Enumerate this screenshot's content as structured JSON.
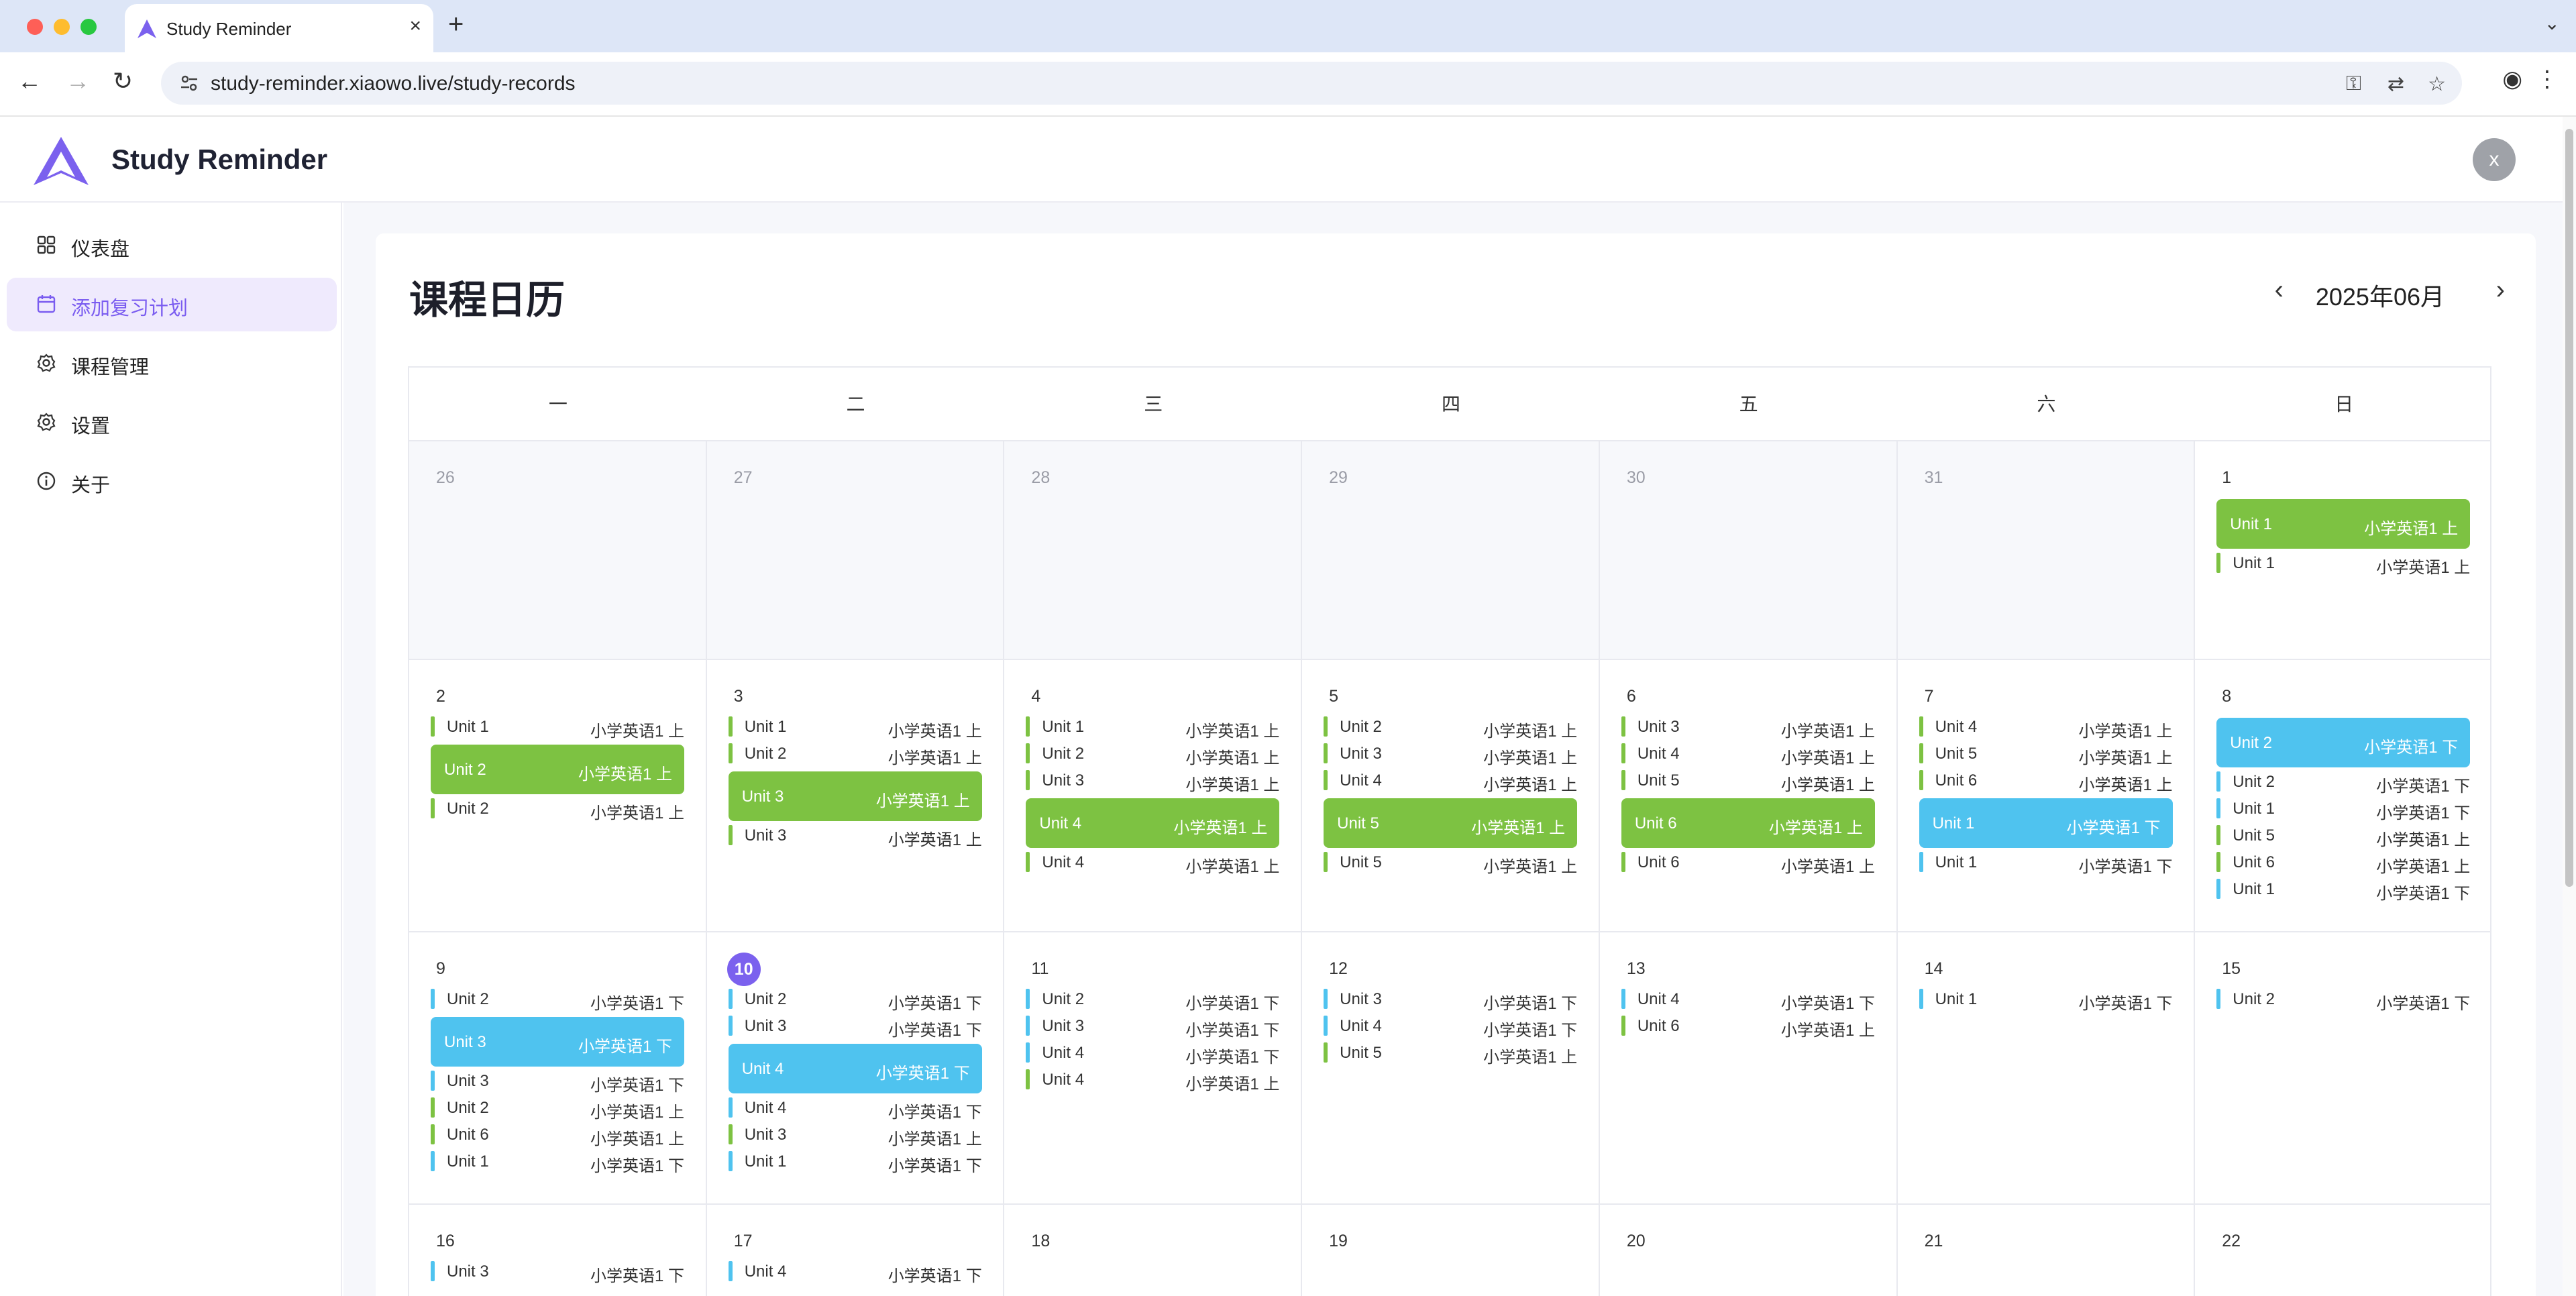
{
  "browser": {
    "tab_title": "Study Reminder",
    "url": "study-reminder.xiaowo.live/study-records"
  },
  "app": {
    "brand": "Study Reminder",
    "avatar_letter": "x"
  },
  "sidebar": {
    "items": [
      {
        "label": "仪表盘",
        "icon": "dashboard-icon"
      },
      {
        "label": "添加复习计划",
        "icon": "calendar-icon",
        "active": true
      },
      {
        "label": "课程管理",
        "icon": "gear-icon"
      },
      {
        "label": "设置",
        "icon": "gear-icon"
      },
      {
        "label": "关于",
        "icon": "info-icon"
      }
    ]
  },
  "main": {
    "title": "课程日历",
    "month": "2025年06月",
    "weekdays": [
      "一",
      "二",
      "三",
      "四",
      "五",
      "六",
      "日"
    ]
  },
  "colors": {
    "accent": "#7b61ee",
    "green": "#7dc242",
    "blue": "#4fc3ef"
  },
  "calendar": {
    "weeks": [
      [
        {
          "day": "26",
          "other": true,
          "events": []
        },
        {
          "day": "27",
          "other": true,
          "events": []
        },
        {
          "day": "28",
          "other": true,
          "events": []
        },
        {
          "day": "29",
          "other": true,
          "events": []
        },
        {
          "day": "30",
          "other": true,
          "events": []
        },
        {
          "day": "31",
          "other": true,
          "events": []
        },
        {
          "day": "1",
          "events": [
            {
              "unit": "Unit 1",
              "course": "小学英语1 上",
              "color": "green",
              "hl": true
            },
            {
              "unit": "Unit 1",
              "course": "小学英语1 上",
              "color": "green"
            }
          ]
        }
      ],
      [
        {
          "day": "2",
          "events": [
            {
              "unit": "Unit 1",
              "course": "小学英语1 上",
              "color": "green"
            },
            {
              "unit": "Unit 2",
              "course": "小学英语1 上",
              "color": "green",
              "hl": true
            },
            {
              "unit": "Unit 2",
              "course": "小学英语1 上",
              "color": "green"
            }
          ]
        },
        {
          "day": "3",
          "events": [
            {
              "unit": "Unit 1",
              "course": "小学英语1 上",
              "color": "green"
            },
            {
              "unit": "Unit 2",
              "course": "小学英语1 上",
              "color": "green"
            },
            {
              "unit": "Unit 3",
              "course": "小学英语1 上",
              "color": "green",
              "hl": true
            },
            {
              "unit": "Unit 3",
              "course": "小学英语1 上",
              "color": "green"
            }
          ]
        },
        {
          "day": "4",
          "events": [
            {
              "unit": "Unit 1",
              "course": "小学英语1 上",
              "color": "green"
            },
            {
              "unit": "Unit 2",
              "course": "小学英语1 上",
              "color": "green"
            },
            {
              "unit": "Unit 3",
              "course": "小学英语1 上",
              "color": "green"
            },
            {
              "unit": "Unit 4",
              "course": "小学英语1 上",
              "color": "green",
              "hl": true
            },
            {
              "unit": "Unit 4",
              "course": "小学英语1 上",
              "color": "green"
            }
          ]
        },
        {
          "day": "5",
          "events": [
            {
              "unit": "Unit 2",
              "course": "小学英语1 上",
              "color": "green"
            },
            {
              "unit": "Unit 3",
              "course": "小学英语1 上",
              "color": "green"
            },
            {
              "unit": "Unit 4",
              "course": "小学英语1 上",
              "color": "green"
            },
            {
              "unit": "Unit 5",
              "course": "小学英语1 上",
              "color": "green",
              "hl": true
            },
            {
              "unit": "Unit 5",
              "course": "小学英语1 上",
              "color": "green"
            }
          ]
        },
        {
          "day": "6",
          "events": [
            {
              "unit": "Unit 3",
              "course": "小学英语1 上",
              "color": "green"
            },
            {
              "unit": "Unit 4",
              "course": "小学英语1 上",
              "color": "green"
            },
            {
              "unit": "Unit 5",
              "course": "小学英语1 上",
              "color": "green"
            },
            {
              "unit": "Unit 6",
              "course": "小学英语1 上",
              "color": "green",
              "hl": true
            },
            {
              "unit": "Unit 6",
              "course": "小学英语1 上",
              "color": "green"
            }
          ]
        },
        {
          "day": "7",
          "events": [
            {
              "unit": "Unit 4",
              "course": "小学英语1 上",
              "color": "green"
            },
            {
              "unit": "Unit 5",
              "course": "小学英语1 上",
              "color": "green"
            },
            {
              "unit": "Unit 6",
              "course": "小学英语1 上",
              "color": "green"
            },
            {
              "unit": "Unit 1",
              "course": "小学英语1 下",
              "color": "blue",
              "hl": true
            },
            {
              "unit": "Unit 1",
              "course": "小学英语1 下",
              "color": "blue"
            }
          ]
        },
        {
          "day": "8",
          "events": [
            {
              "unit": "Unit 2",
              "course": "小学英语1 下",
              "color": "blue",
              "hl": true
            },
            {
              "unit": "Unit 2",
              "course": "小学英语1 下",
              "color": "blue"
            },
            {
              "unit": "Unit 1",
              "course": "小学英语1 下",
              "color": "blue"
            },
            {
              "unit": "Unit 5",
              "course": "小学英语1 上",
              "color": "green"
            },
            {
              "unit": "Unit 6",
              "course": "小学英语1 上",
              "color": "green"
            },
            {
              "unit": "Unit 1",
              "course": "小学英语1 下",
              "color": "blue"
            }
          ]
        }
      ],
      [
        {
          "day": "9",
          "events": [
            {
              "unit": "Unit 2",
              "course": "小学英语1 下",
              "color": "blue"
            },
            {
              "unit": "Unit 3",
              "course": "小学英语1 下",
              "color": "blue",
              "hl": true
            },
            {
              "unit": "Unit 3",
              "course": "小学英语1 下",
              "color": "blue"
            },
            {
              "unit": "Unit 2",
              "course": "小学英语1 上",
              "color": "green"
            },
            {
              "unit": "Unit 6",
              "course": "小学英语1 上",
              "color": "green"
            },
            {
              "unit": "Unit 1",
              "course": "小学英语1 下",
              "color": "blue"
            }
          ]
        },
        {
          "day": "10",
          "today": true,
          "events": [
            {
              "unit": "Unit 2",
              "course": "小学英语1 下",
              "color": "blue"
            },
            {
              "unit": "Unit 3",
              "course": "小学英语1 下",
              "color": "blue"
            },
            {
              "unit": "Unit 4",
              "course": "小学英语1 下",
              "color": "blue",
              "hl": true
            },
            {
              "unit": "Unit 4",
              "course": "小学英语1 下",
              "color": "blue"
            },
            {
              "unit": "Unit 3",
              "course": "小学英语1 上",
              "color": "green"
            },
            {
              "unit": "Unit 1",
              "course": "小学英语1 下",
              "color": "blue"
            }
          ]
        },
        {
          "day": "11",
          "events": [
            {
              "unit": "Unit 2",
              "course": "小学英语1 下",
              "color": "blue"
            },
            {
              "unit": "Unit 3",
              "course": "小学英语1 下",
              "color": "blue"
            },
            {
              "unit": "Unit 4",
              "course": "小学英语1 下",
              "color": "blue"
            },
            {
              "unit": "Unit 4",
              "course": "小学英语1 上",
              "color": "green"
            }
          ]
        },
        {
          "day": "12",
          "events": [
            {
              "unit": "Unit 3",
              "course": "小学英语1 下",
              "color": "blue"
            },
            {
              "unit": "Unit 4",
              "course": "小学英语1 下",
              "color": "blue"
            },
            {
              "unit": "Unit 5",
              "course": "小学英语1 上",
              "color": "green"
            }
          ]
        },
        {
          "day": "13",
          "events": [
            {
              "unit": "Unit 4",
              "course": "小学英语1 下",
              "color": "blue"
            },
            {
              "unit": "Unit 6",
              "course": "小学英语1 上",
              "color": "green"
            }
          ]
        },
        {
          "day": "14",
          "events": [
            {
              "unit": "Unit 1",
              "course": "小学英语1 下",
              "color": "blue"
            }
          ]
        },
        {
          "day": "15",
          "events": [
            {
              "unit": "Unit 2",
              "course": "小学英语1 下",
              "color": "blue"
            }
          ]
        }
      ],
      [
        {
          "day": "16",
          "events": [
            {
              "unit": "Unit 3",
              "course": "小学英语1 下",
              "color": "blue"
            }
          ]
        },
        {
          "day": "17",
          "events": [
            {
              "unit": "Unit 4",
              "course": "小学英语1 下",
              "color": "blue"
            }
          ]
        },
        {
          "day": "18",
          "events": []
        },
        {
          "day": "19",
          "events": []
        },
        {
          "day": "20",
          "events": []
        },
        {
          "day": "21",
          "events": []
        },
        {
          "day": "22",
          "events": []
        }
      ]
    ]
  }
}
